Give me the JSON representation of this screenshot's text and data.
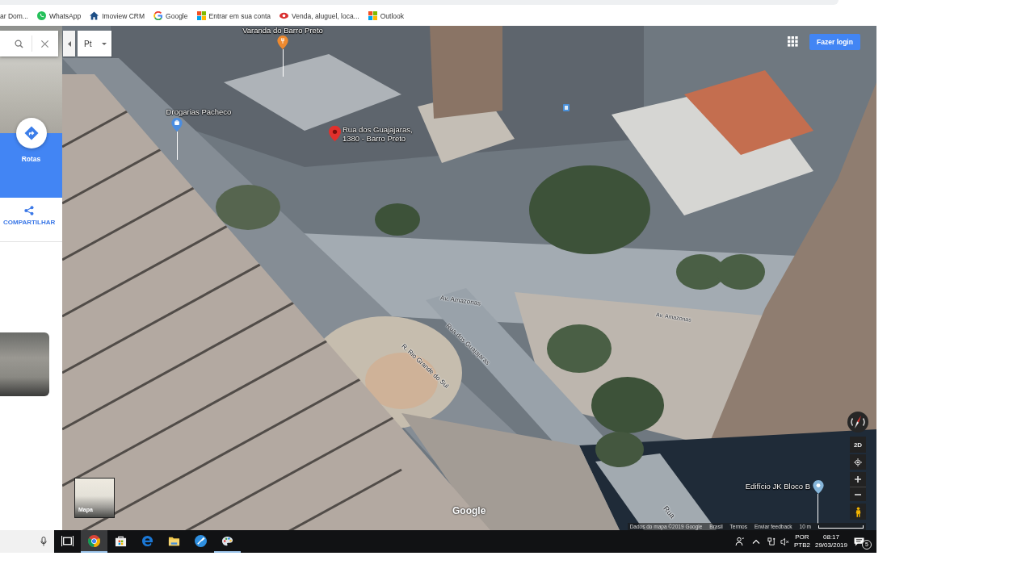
{
  "browser": {
    "bookmarks": [
      {
        "label": "ar Dom...",
        "kind": "plain"
      },
      {
        "label": "WhatsApp",
        "kind": "chat"
      },
      {
        "label": "Imoview CRM",
        "kind": "home"
      },
      {
        "label": "Google",
        "kind": "google"
      },
      {
        "label": "Entrar em sua conta",
        "kind": "windows"
      },
      {
        "label": "Venda, aluguel, loca...",
        "kind": "eye"
      },
      {
        "label": "Outlook",
        "kind": "windows"
      }
    ]
  },
  "side_panel": {
    "actions": [
      {
        "label": "Rotas",
        "kind": "directions"
      },
      {
        "label": "COMPARTILHAR",
        "kind": "share"
      }
    ]
  },
  "language_select": {
    "value": "Pt"
  },
  "map": {
    "places": [
      {
        "lines": [
          "Varanda do Barro Preto"
        ],
        "kind": "food"
      },
      {
        "lines": [
          "Drogarias Pacheco"
        ],
        "kind": "pharmacy"
      },
      {
        "lines": [
          "Rua dos Guajajaras,",
          "1380 - Barro Preto"
        ],
        "kind": "selected"
      },
      {
        "lines": [
          "Edifício JK Bloco B"
        ],
        "kind": "building"
      }
    ],
    "street_labels": [
      "Av. Amazonas",
      "Av. Amazonas",
      "R. Rio Grande do Sul",
      "Rua dos Guajajaras",
      "Rua"
    ],
    "login_button": "Fazer login",
    "view_toggle": "2D",
    "logo": "Google",
    "layer_switcher": "Mapa",
    "attribution": [
      "Dados do mapa ©2019 Google",
      "Brasil",
      "Termos",
      "Enviar feedback"
    ],
    "scale": "10 m"
  },
  "taskbar": {
    "apps": [
      {
        "kind": "browser",
        "selected": true,
        "running": true
      },
      {
        "kind": "store",
        "selected": false,
        "running": false
      },
      {
        "kind": "edge",
        "selected": false,
        "running": false
      },
      {
        "kind": "files",
        "selected": false,
        "running": false
      },
      {
        "kind": "tool",
        "selected": false,
        "running": false
      },
      {
        "kind": "paint",
        "selected": false,
        "running": true
      }
    ],
    "input_language": [
      "POR",
      "PTB2"
    ],
    "time": "08:17",
    "date": "29/03/2019",
    "notification_count": "5"
  }
}
